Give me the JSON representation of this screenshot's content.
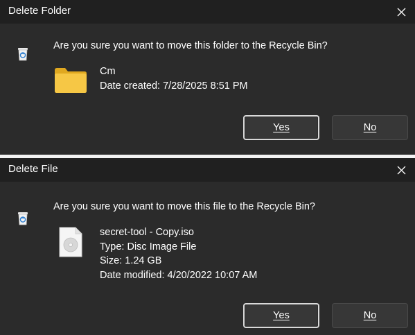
{
  "dialogs": {
    "folder": {
      "title": "Delete Folder",
      "question": "Are you sure you want to move this folder to the Recycle Bin?",
      "item": {
        "name": "Cm",
        "date_created": "Date created: 7/28/2025 8:51 PM"
      },
      "icon": "folder-icon",
      "buttons": {
        "yes": "Yes",
        "no": "No"
      }
    },
    "file": {
      "title": "Delete File",
      "question": "Are you sure you want to move this file to the Recycle Bin?",
      "item": {
        "name": "secret-tool - Copy.iso",
        "type": "Type: Disc Image File",
        "size": "Size: 1.24 GB",
        "date_modified": "Date modified: 4/20/2022 10:07 AM"
      },
      "icon": "disc-image-icon",
      "buttons": {
        "yes": "Yes",
        "no": "No"
      }
    }
  },
  "colors": {
    "dialog_bg": "#2b2b2b",
    "titlebar_bg": "#202020",
    "folder_yellow": "#f4c542",
    "button_bg": "#373737",
    "default_button_border": "#d9d9d9"
  }
}
